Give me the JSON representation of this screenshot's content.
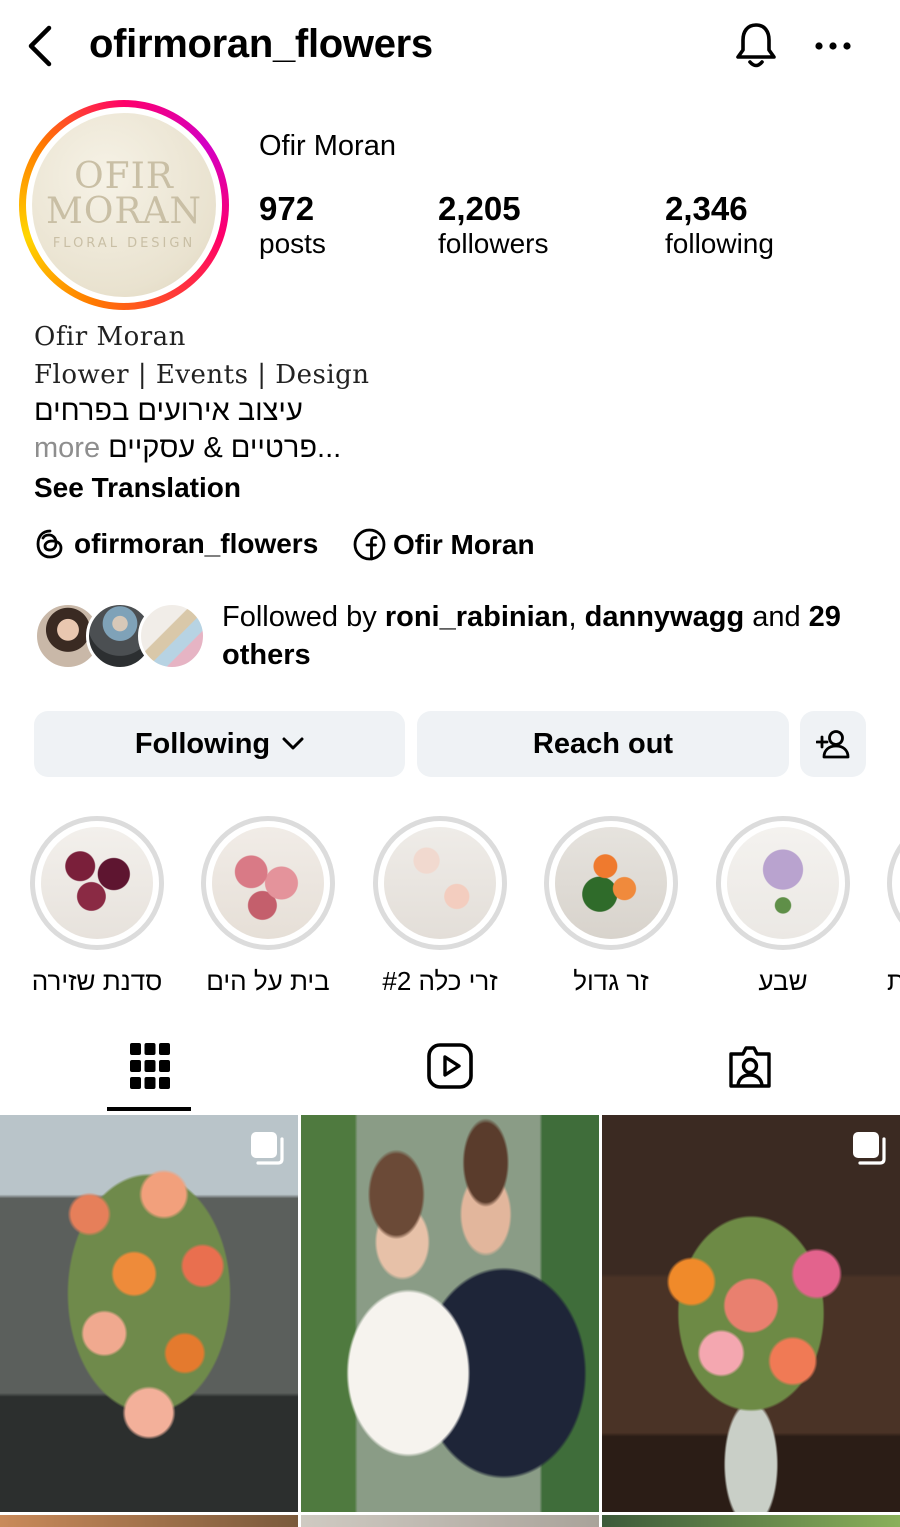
{
  "header": {
    "username": "ofirmoran_flowers"
  },
  "avatar": {
    "line1": "OFIR",
    "line2": "MORAN",
    "line3": "FLORAL DESIGN"
  },
  "profile": {
    "display_name": "Ofir Moran",
    "stats": [
      {
        "value": "972",
        "label": "posts"
      },
      {
        "value": "2,205",
        "label": "followers"
      },
      {
        "value": "2,346",
        "label": "following"
      }
    ]
  },
  "bio": {
    "line1": "Ofir Moran",
    "line2": "Flower | Events | Design",
    "line3": "עיצוב אירועים בפרחים",
    "line4_more": "more",
    "line4_text": "...פרטיים & עסקיים",
    "translate": "See Translation"
  },
  "links": {
    "threads": "ofirmoran_flowers",
    "facebook": "Ofir Moran"
  },
  "followed_by": {
    "prefix": "Followed by ",
    "user1": "roni_rabinian",
    "sep": ", ",
    "user2": "dannywagg",
    "and": " and ",
    "count": "29",
    "others": "others"
  },
  "actions": {
    "following": "Following",
    "reach_out": "Reach out"
  },
  "highlights": [
    {
      "label": "סדנת שזירה"
    },
    {
      "label": "בית על הים"
    },
    {
      "label": "זרי כלה #2"
    },
    {
      "label": "זר גדול"
    },
    {
      "label": "שבע"
    },
    {
      "label": "ת"
    }
  ],
  "colors": {
    "accent_btn": "#eff2f5",
    "tab_indicator": "#000000"
  }
}
